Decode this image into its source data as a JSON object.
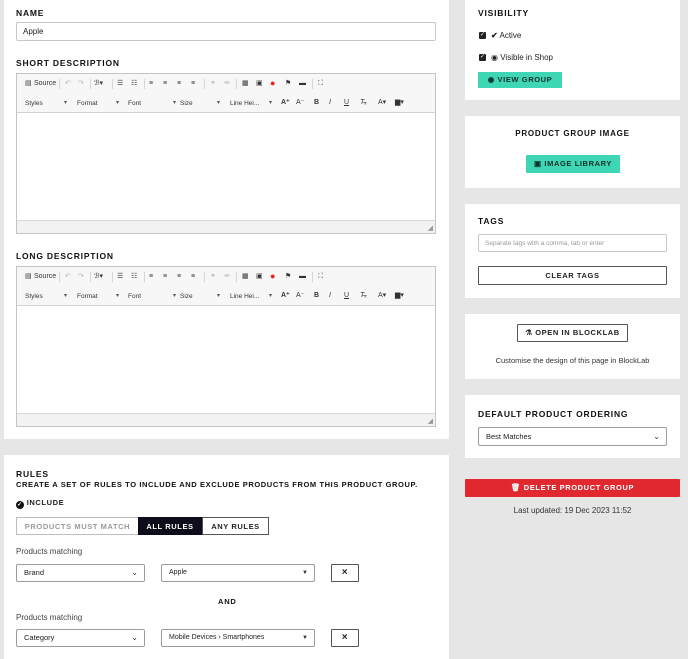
{
  "name": {
    "label": "NAME",
    "value": "Apple"
  },
  "short_description": {
    "label": "SHORT DESCRIPTION"
  },
  "long_description": {
    "label": "LONG DESCRIPTION"
  },
  "editor": {
    "source": "Source",
    "styles": "Styles",
    "format": "Format",
    "font": "Font",
    "size": "Size",
    "line_height": "Line Hei..."
  },
  "rules": {
    "title": "RULES",
    "subtitle": "CREATE A SET OF RULES TO INCLUDE AND EXCLUDE PRODUCTS FROM THIS PRODUCT GROUP.",
    "include": "INCLUDE",
    "modes": [
      "PRODUCTS MUST MATCH",
      "ALL RULES",
      "ANY RULES"
    ],
    "selected_mode": "ALL RULES",
    "matching_label": "Products matching",
    "and_label": "AND",
    "rows": [
      {
        "field": "Brand",
        "value": "Apple",
        "remove": "×"
      },
      {
        "field": "Category",
        "value": "Mobile Devices › Smartphones",
        "remove": "×"
      }
    ]
  },
  "visibility": {
    "title": "VISIBILITY",
    "active": "Active",
    "visible_in_shop": "Visible in Shop",
    "view_group": "VIEW GROUP"
  },
  "image": {
    "title": "PRODUCT GROUP IMAGE",
    "button": "IMAGE LIBRARY"
  },
  "tags": {
    "title": "TAGS",
    "placeholder": "Separate tags with a comma, tab or enter",
    "clear": "CLEAR TAGS"
  },
  "blocklab": {
    "button": "OPEN IN BLOCKLAB",
    "caption": "Customise the design of this page in BlockLab"
  },
  "ordering": {
    "title": "DEFAULT PRODUCT ORDERING",
    "selected": "Best Matches"
  },
  "delete": {
    "label": "DELETE PRODUCT GROUP",
    "last_updated": "Last updated: 19 Dec 2023 11:52"
  },
  "colors": {
    "accent": "#3ed6b5",
    "danger": "#e0282e",
    "dark": "#111111"
  }
}
